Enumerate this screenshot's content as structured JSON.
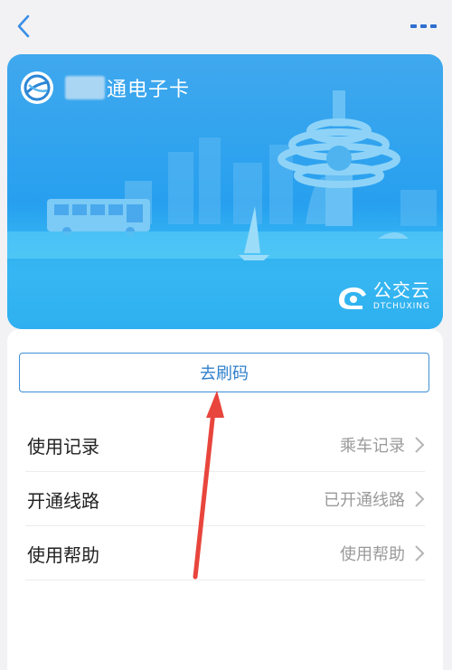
{
  "nav": {
    "back_icon": "chevron-left-icon",
    "more_icon": "more-dots-icon"
  },
  "card": {
    "title_suffix": "通电子卡",
    "brand_name": "公交云",
    "brand_sub": "DTCHUXING"
  },
  "panel": {
    "qr_button": "去刷码",
    "rows": [
      {
        "label": "使用记录",
        "value": "乘车记录"
      },
      {
        "label": "开通线路",
        "value": "已开通线路"
      },
      {
        "label": "使用帮助",
        "value": "使用帮助"
      }
    ]
  },
  "colors": {
    "accent": "#3e8fd6",
    "card_blue": "#27a0ef",
    "annotation_arrow": "#e8453c"
  }
}
